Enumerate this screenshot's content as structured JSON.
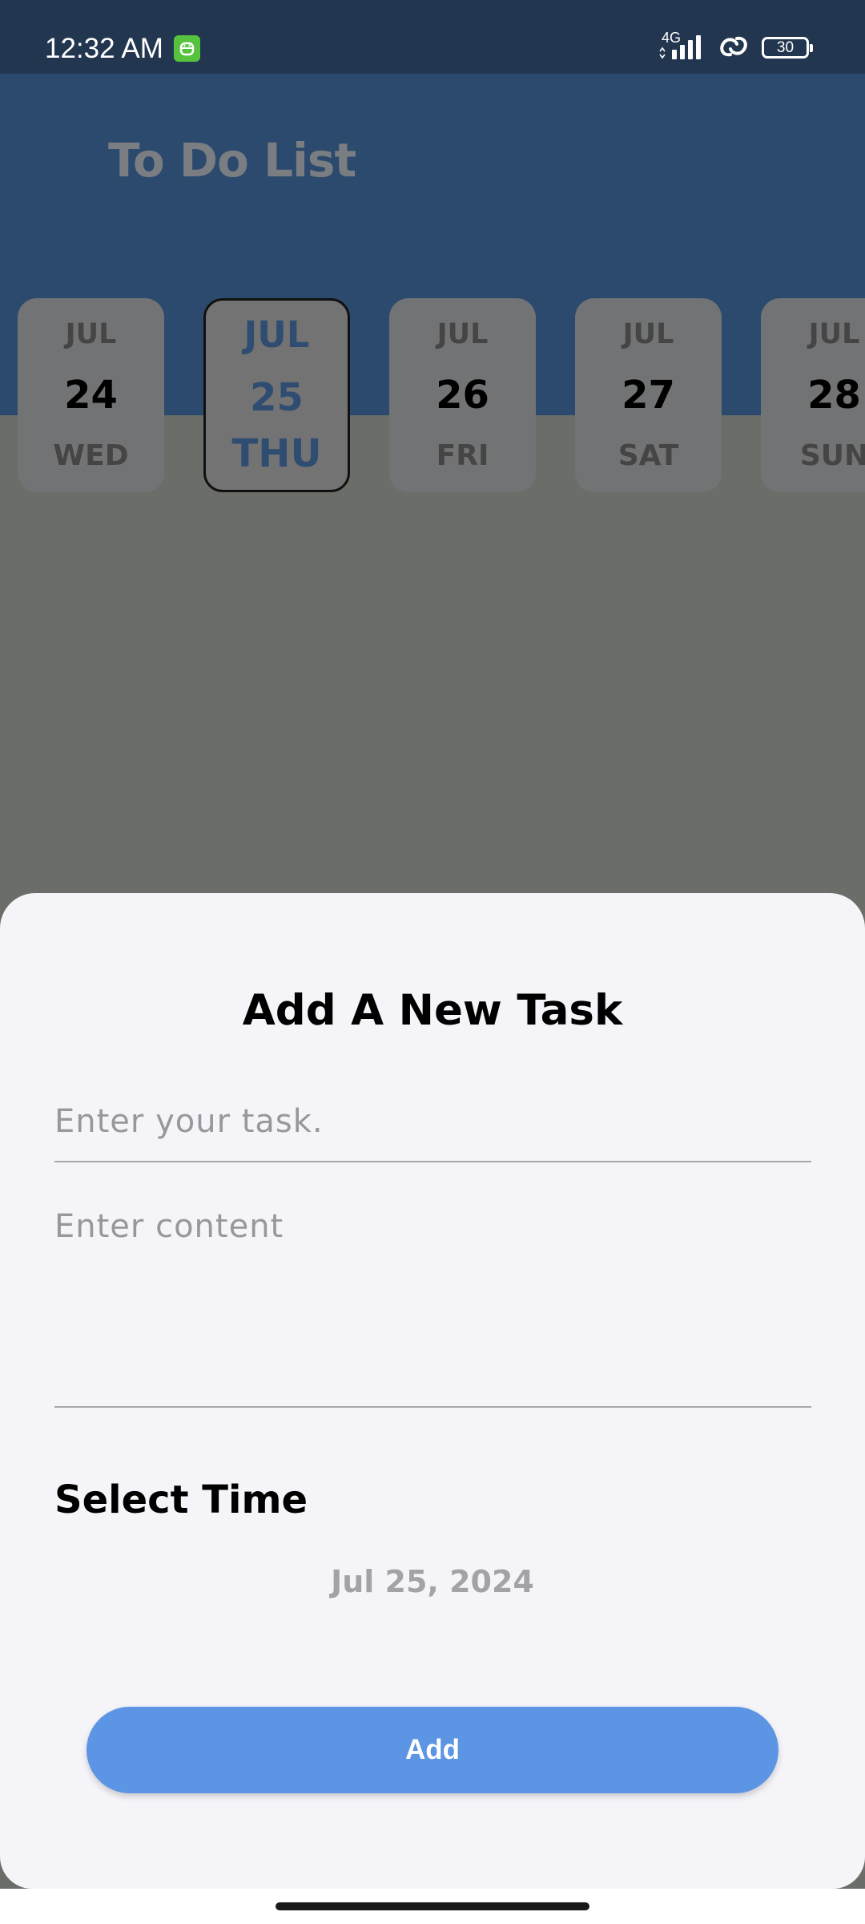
{
  "status_bar": {
    "time": "12:32 AM",
    "network": "4G",
    "battery": "30",
    "icons": [
      "app-notification-icon",
      "signal-icon",
      "hotspot-link-icon",
      "battery-icon"
    ]
  },
  "header": {
    "title": "To Do List"
  },
  "calendar": {
    "selected_index": 1,
    "days": [
      {
        "month": "JUL",
        "day": "24",
        "weekday": "WED"
      },
      {
        "month": "JUL",
        "day": "25",
        "weekday": "THU"
      },
      {
        "month": "JUL",
        "day": "26",
        "weekday": "FRI"
      },
      {
        "month": "JUL",
        "day": "27",
        "weekday": "SAT"
      },
      {
        "month": "JUL",
        "day": "28",
        "weekday": "SUN"
      }
    ]
  },
  "sheet": {
    "title": "Add A New Task",
    "task_placeholder": "Enter your task.",
    "content_placeholder": "Enter content",
    "task_value": "",
    "content_value": "",
    "time_label": "Select Time",
    "date_value": "Jul 25, 2024",
    "add_label": "Add"
  },
  "colors": {
    "status_bar": "#233650",
    "header": "#2c4a6d",
    "overlay": "#6a6d68",
    "sheet": "#f5f4f9",
    "accent": "#5c95e4",
    "selected_text": "#2f4d71"
  }
}
